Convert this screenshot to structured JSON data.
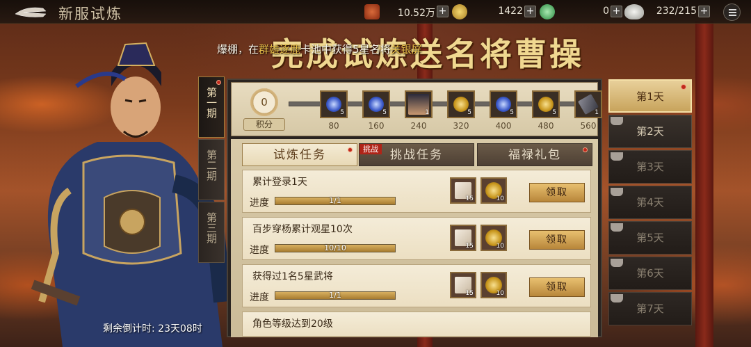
{
  "header": {
    "title": "新服试炼",
    "resources": [
      {
        "icon": "copper-coins-icon",
        "value": "10.52万"
      },
      {
        "icon": "gold-ingot-icon",
        "value": "1422"
      },
      {
        "icon": "jade-coin-icon",
        "value": "0"
      },
      {
        "icon": "silver-ingot-icon",
        "value": "232/215"
      }
    ]
  },
  "banner": {
    "title": "完成试炼送名将曹操",
    "marquee_prefix": "爆棚，在",
    "marquee_hl1": "群雄逐鹿",
    "marquee_mid": "卡池中获得5星名将",
    "marquee_hl2": "关银屏"
  },
  "phases": [
    {
      "label": "第一期"
    },
    {
      "label": "第二期"
    },
    {
      "label": "第三期"
    }
  ],
  "score": {
    "value": "0",
    "label": "积分"
  },
  "milestones": [
    {
      "points": "80",
      "count": "5",
      "icon": "blue-orb-icon"
    },
    {
      "points": "160",
      "count": "5",
      "icon": "blue-orb-icon"
    },
    {
      "points": "240",
      "count": "1",
      "icon": "general-portrait-icon"
    },
    {
      "points": "320",
      "count": "5",
      "icon": "gold-coin-icon"
    },
    {
      "points": "400",
      "count": "5",
      "icon": "blue-orb-icon"
    },
    {
      "points": "480",
      "count": "5",
      "icon": "gold-coin-icon"
    },
    {
      "points": "560",
      "count": "1",
      "icon": "scroll-item-icon"
    }
  ],
  "task_tabs": [
    {
      "label": "试炼任务"
    },
    {
      "label": "挑战任务",
      "tag": "挑战"
    },
    {
      "label": "福禄礼包"
    }
  ],
  "progress_label": "进度",
  "claim_label": "领取",
  "tasks": [
    {
      "name": "累计登录1天",
      "progress": "1/1",
      "fraction": 1.0,
      "rewards": [
        {
          "icon": "flag-icon",
          "count": "15"
        },
        {
          "icon": "gold-coin-icon",
          "count": "10"
        }
      ]
    },
    {
      "name": "百步穿杨累计观星10次",
      "progress": "10/10",
      "fraction": 1.0,
      "rewards": [
        {
          "icon": "flag-icon",
          "count": "15"
        },
        {
          "icon": "gold-coin-icon",
          "count": "10"
        }
      ]
    },
    {
      "name": "获得过1名5星武将",
      "progress": "1/1",
      "fraction": 1.0,
      "rewards": [
        {
          "icon": "flag-icon",
          "count": "15"
        },
        {
          "icon": "gold-coin-icon",
          "count": "10"
        }
      ]
    },
    {
      "name": "角色等级达到20级"
    }
  ],
  "days": [
    {
      "label": "第1天",
      "state": "active"
    },
    {
      "label": "第2天",
      "state": "normal"
    },
    {
      "label": "第3天",
      "state": "locked"
    },
    {
      "label": "第4天",
      "state": "locked"
    },
    {
      "label": "第5天",
      "state": "locked"
    },
    {
      "label": "第6天",
      "state": "locked"
    },
    {
      "label": "第7天",
      "state": "locked"
    }
  ],
  "countdown": "剩余倒计时: 23天08时",
  "colors": {
    "gold": "#e8c048",
    "badge_red": "#c0281c",
    "accent": "#f0d890"
  }
}
